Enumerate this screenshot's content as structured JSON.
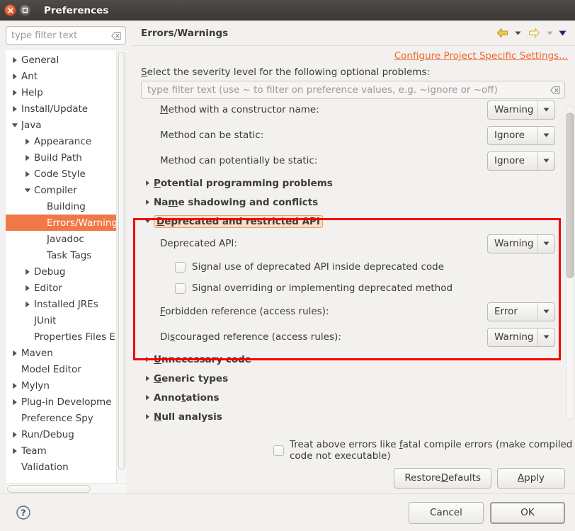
{
  "window": {
    "title": "Preferences",
    "close_icon": "close-icon",
    "maximize_icon": "maximize-icon"
  },
  "sidebar": {
    "filter": {
      "value": "",
      "placeholder": "type filter text",
      "clear_icon": "clear-icon"
    },
    "items": [
      {
        "label": "General",
        "indent": 0,
        "twisty": "collapsed",
        "selected": false
      },
      {
        "label": "Ant",
        "indent": 0,
        "twisty": "collapsed",
        "selected": false
      },
      {
        "label": "Help",
        "indent": 0,
        "twisty": "collapsed",
        "selected": false
      },
      {
        "label": "Install/Update",
        "indent": 0,
        "twisty": "collapsed",
        "selected": false
      },
      {
        "label": "Java",
        "indent": 0,
        "twisty": "expanded",
        "selected": false
      },
      {
        "label": "Appearance",
        "indent": 1,
        "twisty": "collapsed",
        "selected": false
      },
      {
        "label": "Build Path",
        "indent": 1,
        "twisty": "collapsed",
        "selected": false
      },
      {
        "label": "Code Style",
        "indent": 1,
        "twisty": "collapsed",
        "selected": false
      },
      {
        "label": "Compiler",
        "indent": 1,
        "twisty": "expanded",
        "selected": false
      },
      {
        "label": "Building",
        "indent": 2,
        "twisty": "none",
        "selected": false
      },
      {
        "label": "Errors/Warning",
        "indent": 2,
        "twisty": "none",
        "selected": true
      },
      {
        "label": "Javadoc",
        "indent": 2,
        "twisty": "none",
        "selected": false
      },
      {
        "label": "Task Tags",
        "indent": 2,
        "twisty": "none",
        "selected": false
      },
      {
        "label": "Debug",
        "indent": 1,
        "twisty": "collapsed",
        "selected": false
      },
      {
        "label": "Editor",
        "indent": 1,
        "twisty": "collapsed",
        "selected": false
      },
      {
        "label": "Installed JREs",
        "indent": 1,
        "twisty": "collapsed",
        "selected": false
      },
      {
        "label": "JUnit",
        "indent": 1,
        "twisty": "none",
        "selected": false
      },
      {
        "label": "Properties Files E",
        "indent": 1,
        "twisty": "none",
        "selected": false
      },
      {
        "label": "Maven",
        "indent": 0,
        "twisty": "collapsed",
        "selected": false
      },
      {
        "label": "Model Editor",
        "indent": 0,
        "twisty": "none",
        "selected": false
      },
      {
        "label": "Mylyn",
        "indent": 0,
        "twisty": "collapsed",
        "selected": false
      },
      {
        "label": "Plug-in Developme",
        "indent": 0,
        "twisty": "collapsed",
        "selected": false
      },
      {
        "label": "Preference Spy",
        "indent": 0,
        "twisty": "none",
        "selected": false
      },
      {
        "label": "Run/Debug",
        "indent": 0,
        "twisty": "collapsed",
        "selected": false
      },
      {
        "label": "Team",
        "indent": 0,
        "twisty": "collapsed",
        "selected": false
      },
      {
        "label": "Validation",
        "indent": 0,
        "twisty": "none",
        "selected": false
      }
    ]
  },
  "page": {
    "title": "Errors/Warnings",
    "nav": {
      "back_icon": "back-arrow-icon",
      "back_caret_icon": "chevron-down-icon",
      "forward_icon": "forward-arrow-icon",
      "forward_caret_icon": "chevron-down-icon",
      "menu_icon": "chevron-down-icon"
    },
    "configure_link": "Configure Project Specific Settings...",
    "hint": "Select the severity level for the following optional problems:",
    "inner_filter": {
      "value": "",
      "placeholder": "type filter text (use ~ to filter on preference values, e.g. ~ignore or ~off)",
      "clear_icon": "clear-icon"
    },
    "options": [
      {
        "kind": "option",
        "label": "Method with a constructor name:",
        "mnemonic": "M",
        "value": "Warning"
      },
      {
        "kind": "option",
        "label": "Method can be static:",
        "mnemonic": "",
        "value": "Ignore"
      },
      {
        "kind": "option",
        "label": "Method can potentially be static:",
        "mnemonic": "",
        "value": "Ignore"
      },
      {
        "kind": "section",
        "label": "Potential programming problems",
        "mnemonic": "P",
        "expanded": false,
        "focused": false
      },
      {
        "kind": "section",
        "label": "Name shadowing and conflicts",
        "mnemonic": "m",
        "expanded": false,
        "focused": false
      },
      {
        "kind": "section",
        "label": "Deprecated and restricted API",
        "mnemonic": "D",
        "expanded": true,
        "focused": true
      },
      {
        "kind": "option",
        "label": "Deprecated API:",
        "mnemonic": "",
        "value": "Warning"
      },
      {
        "kind": "check",
        "label": "Signal use of deprecated API inside deprecated code",
        "checked": false
      },
      {
        "kind": "check",
        "label": "Signal overriding or implementing deprecated method",
        "checked": false
      },
      {
        "kind": "option",
        "label": "Forbidden reference (access rules):",
        "mnemonic": "F",
        "value": "Error"
      },
      {
        "kind": "option",
        "label": "Discouraged reference (access rules):",
        "mnemonic": "s",
        "value": "Warning"
      },
      {
        "kind": "section",
        "label": "Unnecessary code",
        "mnemonic": "U",
        "expanded": false,
        "focused": false
      },
      {
        "kind": "section",
        "label": "Generic types",
        "mnemonic": "G",
        "expanded": false,
        "focused": false
      },
      {
        "kind": "section",
        "label": "Annotations",
        "mnemonic": "t",
        "expanded": false,
        "focused": false
      },
      {
        "kind": "section",
        "label": "Null analysis",
        "mnemonic": "N",
        "expanded": false,
        "focused": false
      }
    ],
    "fatal_checkbox": {
      "label_before": "Treat above errors like ",
      "mnemonic": "f",
      "label_after": "atal compile errors (make compiled code not executable)",
      "checked": false
    },
    "restore_defaults": {
      "before": "Restore ",
      "mnemonic": "D",
      "after": "efaults"
    },
    "apply": {
      "before": "",
      "mnemonic": "A",
      "after": "pply"
    }
  },
  "footer": {
    "help_icon": "help-icon",
    "cancel": "Cancel",
    "ok": "OK"
  },
  "annotation": {
    "highlight_color": "#f60000",
    "accent_color": "#f07746"
  }
}
